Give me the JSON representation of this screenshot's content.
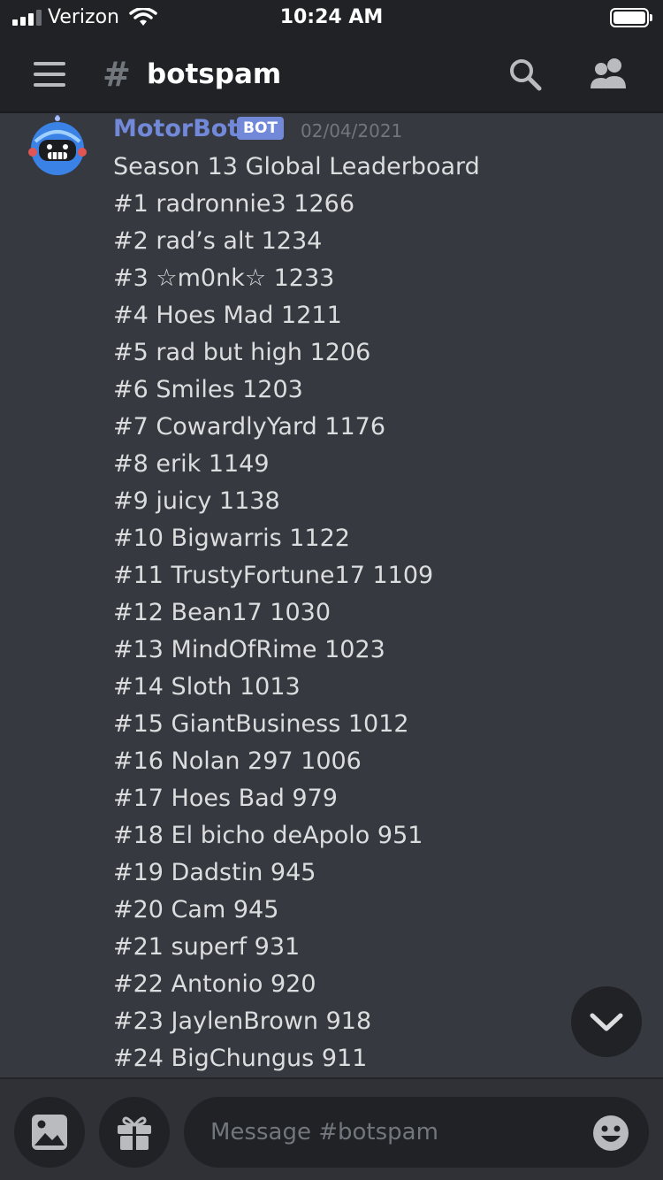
{
  "status_bar": {
    "carrier": "Verizon",
    "time": "10:24 AM",
    "signal_bars": 3,
    "signal_bars_total": 4,
    "battery_level": 1.0
  },
  "header": {
    "channel_name": "botspam",
    "icons": [
      "menu-icon",
      "hash-icon",
      "search-icon",
      "members-icon"
    ]
  },
  "message": {
    "author": "MotorBot",
    "badge": "BOT",
    "timestamp": "02/04/2021",
    "lines": [
      "Season 13 Global Leaderboard",
      "#1 radronnie3 1266",
      "#2 rad’s alt 1234",
      "#3 ☆m0nk☆ 1233",
      "#4 Hoes Mad 1211",
      "#5 rad but high 1206",
      "#6 Smiles 1203",
      "#7 CowardlyYard 1176",
      "#8 erik 1149",
      "#9 juicy 1138",
      "#10 Bigwarris 1122",
      "#11 TrustyFortune17 1109",
      "#12 Bean17 1030",
      "#13 MindOfRime 1023",
      "#14 Sloth 1013",
      "#15 GiantBusiness 1012",
      "#16 Nolan 297 1006",
      "#17 Hoes Bad 979",
      "#18 El bicho deApolo 951",
      "#19 Dadstin 945",
      "#20 Cam 945",
      "#21 superf 931",
      "#22 Antonio 920",
      "#23 JaylenBrown 918",
      "#24 BigChungus 911"
    ]
  },
  "composer": {
    "placeholder": "Message #botspam",
    "icons": [
      "image-icon",
      "gift-icon",
      "emoji-icon",
      "chevron-down-icon"
    ]
  },
  "colors": {
    "background": "#36393f",
    "header": "#202225",
    "accent": "#7289da",
    "text": "#dcddde",
    "muted": "#72767d"
  }
}
